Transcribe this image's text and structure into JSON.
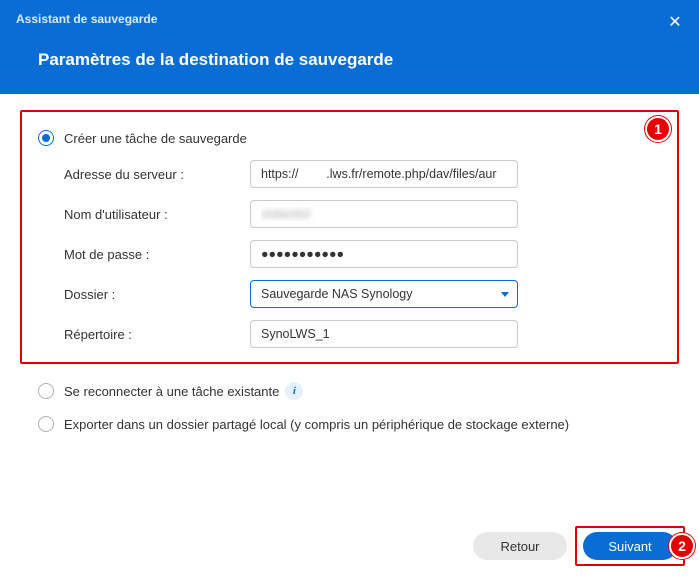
{
  "header": {
    "app_title": "Assistant de sauvegarde",
    "page_title": "Paramètres de la destination de sauvegarde"
  },
  "badges": {
    "one": "1",
    "two": "2"
  },
  "options": {
    "create": "Créer une tâche de sauvegarde",
    "reconnect": "Se reconnecter à une tâche existante",
    "export": "Exporter dans un dossier partagé local (y compris un périphérique de stockage externe)"
  },
  "fields": {
    "server_label": "Adresse du serveur :",
    "server_value": "https://        .lws.fr/remote.php/dav/files/aur",
    "user_label": "Nom d'utilisateur :",
    "user_value": "redacted",
    "pass_label": "Mot de passe :",
    "pass_value": "●●●●●●●●●●●",
    "folder_label": "Dossier :",
    "folder_value": "Sauvegarde NAS Synology",
    "dir_label": "Répertoire :",
    "dir_value": "SynoLWS_1"
  },
  "buttons": {
    "back": "Retour",
    "next": "Suivant"
  },
  "icons": {
    "info": "i",
    "close": "✕"
  }
}
